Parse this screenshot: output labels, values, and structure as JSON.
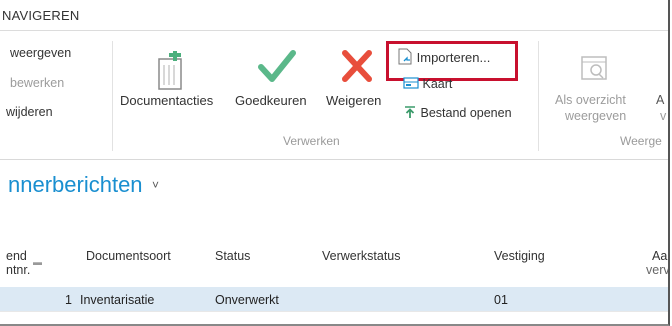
{
  "header": {
    "title": "NAVIGEREN"
  },
  "ribbon": {
    "left_actions": [
      {
        "label": "weergeven",
        "disabled": false
      },
      {
        "label": "bewerken",
        "disabled": true
      },
      {
        "label": "wijderen",
        "disabled": false
      }
    ],
    "big_actions": {
      "documentacties": "Documentacties",
      "goedkeuren": "Goedkeuren",
      "weigeren": "Weigeren"
    },
    "small_actions": {
      "importeren": "Importeren...",
      "kaart": "Kaart",
      "bestand_openen": "Bestand openen"
    },
    "group_verwerken": "Verwerken",
    "als_overzicht": {
      "line1": "Als overzicht",
      "line2": "weergeven"
    },
    "group_weerge": "Weerge",
    "cut_letters": {
      "a": "A",
      "v": "v"
    }
  },
  "page": {
    "title": "nnerberichten",
    "title_chevron": "˅"
  },
  "table": {
    "columns": {
      "c0_line1": "end",
      "c0_line2": "ntnr.",
      "documentsoort": "Documentsoort",
      "status": "Status",
      "verwerkstatus": "Verwerkstatus",
      "vestiging": "Vestiging",
      "aa_line1": "Aa",
      "aa_line2": "verv"
    },
    "rows": [
      {
        "nr": "1",
        "documentsoort": "Inventarisatie",
        "status": "Onverwerkt",
        "verwerkstatus": "",
        "vestiging": "01"
      }
    ]
  },
  "colors": {
    "accent": "#1a8fd0",
    "highlight": "#c8102e",
    "selected_row": "#dce9f4",
    "approve_green": "#5bb88a",
    "reject_red": "#e84e3c"
  },
  "icons": [
    "document-actions-icon",
    "checkmark-icon",
    "x-icon",
    "import-document-icon",
    "map-card-icon",
    "open-file-icon",
    "list-view-icon",
    "sort-icon"
  ]
}
